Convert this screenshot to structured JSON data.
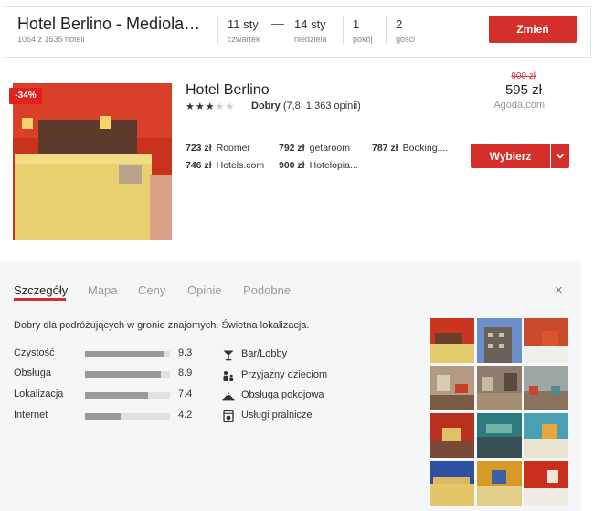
{
  "search": {
    "hotel_title": "Hotel Berlino - Mediola…",
    "result_count": "1064 z 1535 hoteli",
    "checkin_date": "11 sty",
    "checkin_day": "czwartek",
    "dash": "—",
    "checkout_date": "14 sty",
    "checkout_day": "niedziela",
    "rooms_value": "1",
    "rooms_label": "pokój",
    "guests_value": "2",
    "guests_label": "gości",
    "change_label": "Zmień"
  },
  "hotel": {
    "discount": "-34%",
    "name": "Hotel Berlino",
    "stars_filled": 3,
    "stars_total": 5,
    "rating_word": "Dobry",
    "rating_detail": "(7,8, 1 363 opinii)",
    "old_price": "900 zł",
    "price": "595 zł",
    "price_source": "Agoda.com",
    "select_label": "Wybierz",
    "offers": [
      {
        "price": "723 zł",
        "site": "Roomer"
      },
      {
        "price": "792 zł",
        "site": "getaroom"
      },
      {
        "price": "787 zł",
        "site": "Booking...."
      },
      {
        "price": "746 zł",
        "site": "Hotels.com"
      },
      {
        "price": "900 zł",
        "site": "Hotelopia..."
      }
    ]
  },
  "details": {
    "tabs": [
      "Szczegóły",
      "Mapa",
      "Ceny",
      "Opinie",
      "Podobne"
    ],
    "active_tab": "Szczegóły",
    "close_glyph": "×",
    "summary": "Dobry dla podróżujących w gronie znajomych. Świetna lokalizacja.",
    "scores": [
      {
        "label": "Czystość",
        "value": "9.3",
        "fraction": 0.93
      },
      {
        "label": "Obsługa",
        "value": "8.9",
        "fraction": 0.89
      },
      {
        "label": "Lokalizacja",
        "value": "7.4",
        "fraction": 0.74
      },
      {
        "label": "Internet",
        "value": "4.2",
        "fraction": 0.42
      }
    ],
    "amenities": [
      {
        "label": "Bar/Lobby",
        "icon": "cocktail-icon"
      },
      {
        "label": "Przyjazny dzieciom",
        "icon": "family-icon"
      },
      {
        "label": "Obsługa pokojowa",
        "icon": "room-service-icon"
      },
      {
        "label": "Usługi pralnicze",
        "icon": "washing-machine-icon"
      }
    ]
  },
  "colors": {
    "accent": "#d42f2a",
    "discount_badge": "#e2201e",
    "panel_bg": "#f5f6f7"
  }
}
